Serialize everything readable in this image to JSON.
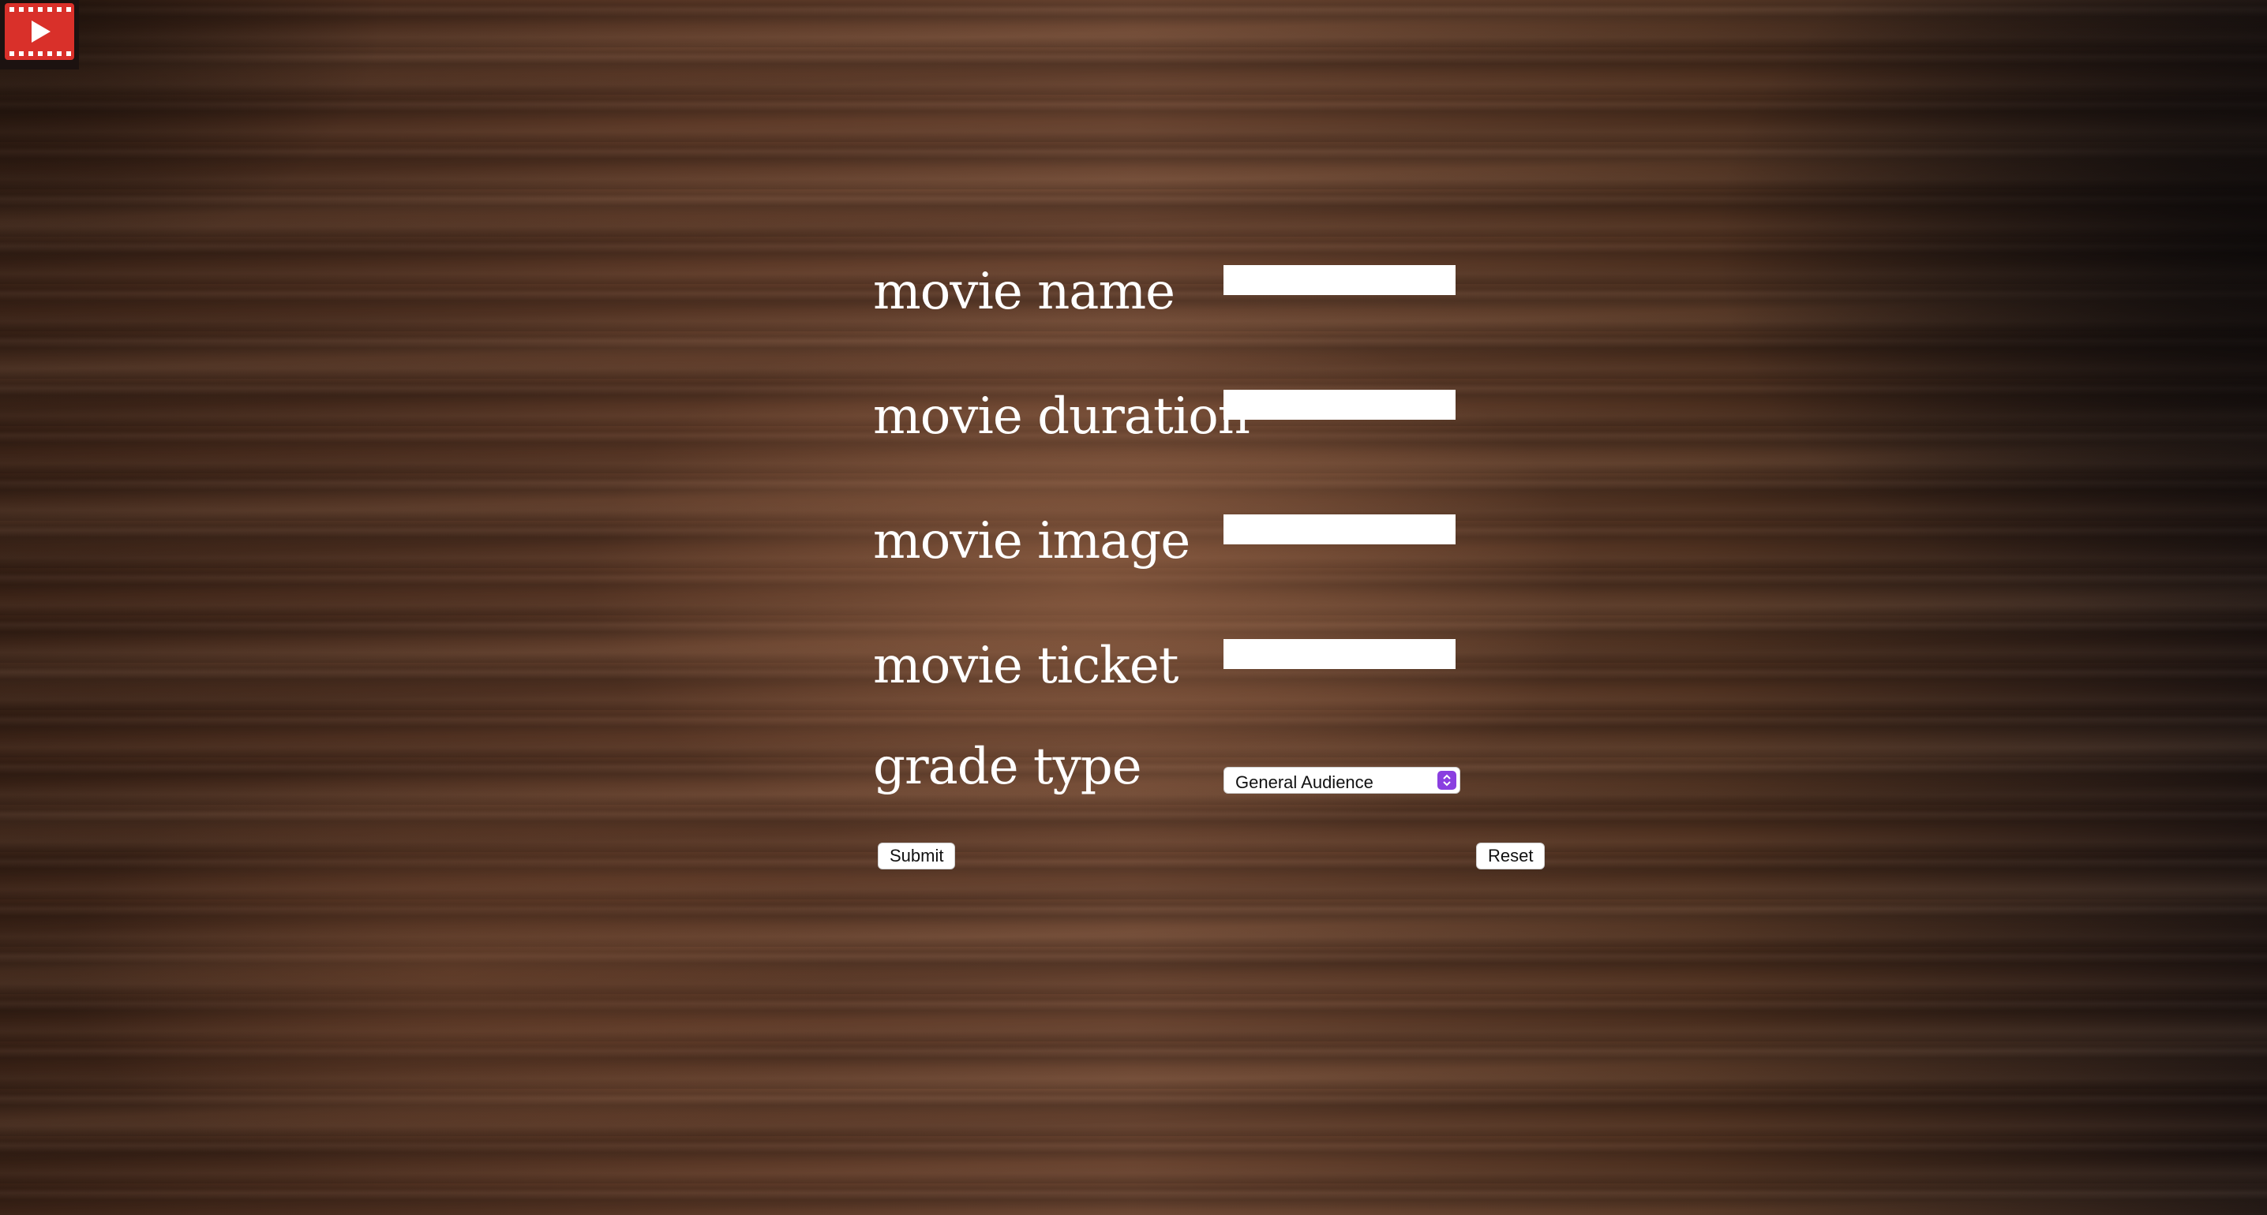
{
  "logo": {
    "icon": "film-play-icon",
    "color": "#d9302a"
  },
  "form": {
    "fields": [
      {
        "label": "movie name",
        "value": ""
      },
      {
        "label": "movie duration",
        "value": ""
      },
      {
        "label": "movie image",
        "value": ""
      },
      {
        "label": "movie ticket",
        "value": ""
      }
    ],
    "grade": {
      "label": "grade type",
      "selected": "General Audience"
    },
    "submit_label": "Submit",
    "reset_label": "Reset"
  }
}
